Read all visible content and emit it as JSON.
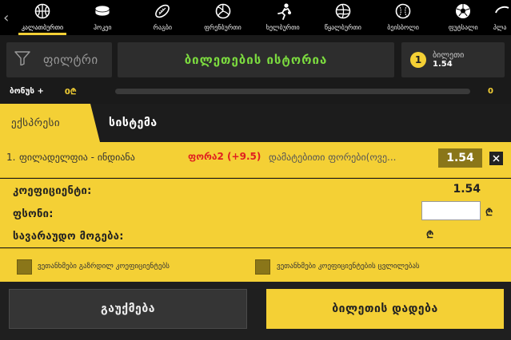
{
  "sports_nav": {
    "left_arrow": "‹",
    "items": [
      {
        "label": "კალათბურთი",
        "icon": "basketball-icon",
        "active": true
      },
      {
        "label": "ჰოკეი",
        "icon": "hockey-puck-icon",
        "active": false
      },
      {
        "label": "რაგბი",
        "icon": "rugby-ball-icon",
        "active": false
      },
      {
        "label": "ფრენბურთი",
        "icon": "volleyball-icon",
        "active": false
      },
      {
        "label": "ხელბურთი",
        "icon": "handball-icon",
        "active": false
      },
      {
        "label": "წყალბურთი",
        "icon": "water-polo-icon",
        "active": false
      },
      {
        "label": "ბეისბოლი",
        "icon": "baseball-icon",
        "active": false
      },
      {
        "label": "ფუტსალი",
        "icon": "futsal-icon",
        "active": false
      },
      {
        "label": "პლა",
        "icon": "beach-icon",
        "active": false
      }
    ]
  },
  "header": {
    "filter_label": "ფილტრი",
    "history_label": "ბილეთების ისტორია",
    "ticket_count": "1",
    "ticket_label": "ბილეთი",
    "ticket_odds": "1.54"
  },
  "bonus": {
    "label": "ბონუს +",
    "amount": "0₾",
    "right_value": "0"
  },
  "tabs": {
    "express": "ექსპრესი",
    "system": "სისტემა"
  },
  "bet": {
    "number": "1.",
    "match": "ფილადელფია - ინდიანა",
    "market": "ფორა2 (+9.5)",
    "description": "დამატებითი ფორები(ოვე...",
    "odds": "1.54"
  },
  "calc": {
    "coef_label": "კოეფიციენტი:",
    "coef_value": "1.54",
    "stake_label": "ფსონი:",
    "stake_value": "",
    "currency": "₾",
    "win_label": "სავარაუდო მოგება:"
  },
  "checks": {
    "first": "ვეთანხმები გაზრდილ კოეფიციენტებს",
    "second": "ვეთანხმები კოეფიციენტების ცვლილებას"
  },
  "footer": {
    "cancel": "გაუქმება",
    "place": "ბილეთის დადება"
  },
  "colors": {
    "accent": "#f4d035",
    "green": "#7cdb3f",
    "red": "#e02020"
  }
}
